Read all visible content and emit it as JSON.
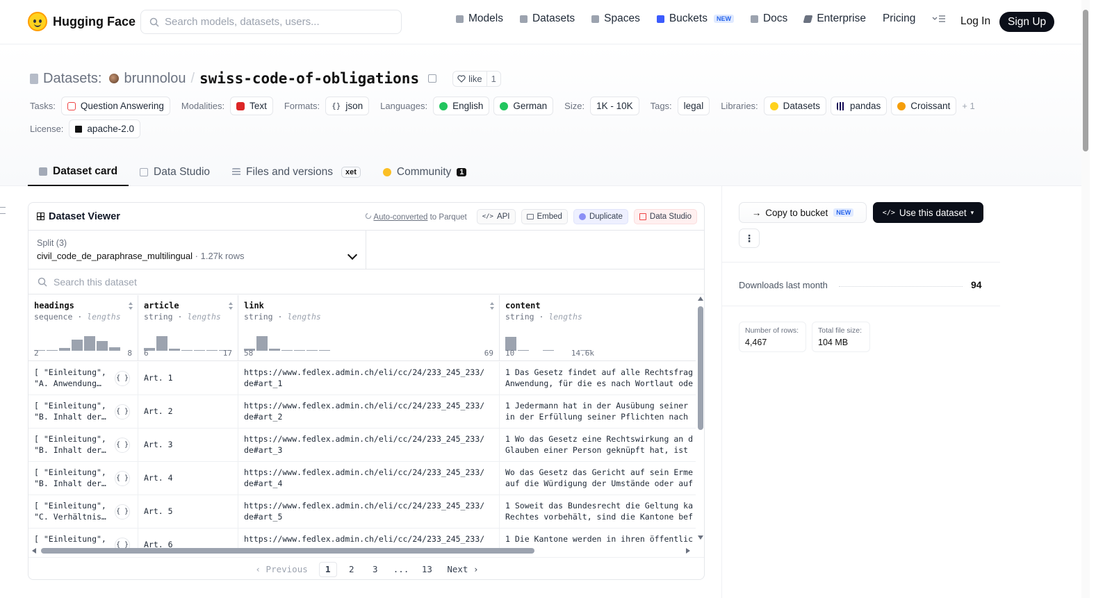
{
  "nav": {
    "brand": "Hugging Face",
    "search_placeholder": "Search models, datasets, users...",
    "items": [
      {
        "label": "Models",
        "icon": "cube-icon"
      },
      {
        "label": "Datasets",
        "icon": "database-icon"
      },
      {
        "label": "Spaces",
        "icon": "grid-icon"
      },
      {
        "label": "Buckets",
        "icon": "bucket-icon",
        "tag": "NEW"
      },
      {
        "label": "Docs",
        "icon": "book-icon"
      },
      {
        "label": "Enterprise",
        "icon": "building-icon"
      },
      {
        "label": "Pricing"
      }
    ],
    "login": "Log In",
    "signup": "Sign Up"
  },
  "header": {
    "prefix": "Datasets:",
    "owner": "brunnolou",
    "repo": "swiss-code-of-obligations",
    "like_label": "like",
    "like_count": "1",
    "tasks_label": "Tasks:",
    "task": "Question Answering",
    "modalities_label": "Modalities:",
    "modality": "Text",
    "formats_label": "Formats:",
    "format": "json",
    "languages_label": "Languages:",
    "languages": [
      "English",
      "German"
    ],
    "size_label": "Size:",
    "size": "1K - 10K",
    "tags_label": "Tags:",
    "tag": "legal",
    "libraries_label": "Libraries:",
    "libraries": [
      "Datasets",
      "pandas",
      "Croissant"
    ],
    "more": "+ 1",
    "license_label": "License:",
    "license": "apache-2.0"
  },
  "tabs": [
    {
      "label": "Dataset card",
      "active": true
    },
    {
      "label": "Data Studio"
    },
    {
      "label": "Files and versions",
      "extra": "xet"
    },
    {
      "label": "Community",
      "badge": "1"
    }
  ],
  "viewer": {
    "title": "Dataset Viewer",
    "autoconv_link": "Auto-converted",
    "autoconv_rest": " to Parquet",
    "buttons": [
      "API",
      "Embed",
      "Duplicate",
      "Data Studio"
    ],
    "split_label": "Split (3)",
    "split_value": "civil_code_de_paraphrase_multilingual",
    "split_rows": "1.27k rows",
    "search_placeholder": "Search this dataset",
    "columns": [
      {
        "name": "headings",
        "type": "sequence",
        "hint": "lengths",
        "min": "2",
        "max": "8",
        "hist": [
          0.05,
          0.05,
          0.15,
          0.6,
          0.8,
          0.55,
          0.2
        ]
      },
      {
        "name": "article",
        "type": "string",
        "hint": "lengths",
        "min": "6",
        "max": "17",
        "hist": [
          0.15,
          0.8,
          0.12,
          0.05,
          0.05,
          0.05,
          0.05
        ]
      },
      {
        "name": "link",
        "type": "string",
        "hint": "lengths",
        "min": "58",
        "max": "69",
        "hist": [
          0.1,
          0.8,
          0.12,
          0.05,
          0.05,
          0.05,
          0.05
        ]
      },
      {
        "name": "content",
        "type": "string",
        "hint": "lengths",
        "min": "10",
        "max": "14.6k",
        "hist": [
          0.75,
          0.04,
          0,
          0.03,
          0,
          0,
          0.03
        ]
      }
    ],
    "rows": [
      {
        "headings": "[ \"Einleitung\",\n\"A. Anwendung…",
        "article": "Art. 1",
        "link": "https://www.fedlex.admin.ch/eli/cc/24/233_245_233/\nde#art_1",
        "content": "1 Das Gesetz findet auf alle Rechtsfrag\nAnwendung, für die es nach Wortlaut ode"
      },
      {
        "headings": "[ \"Einleitung\",\n\"B. Inhalt der…",
        "article": "Art. 2",
        "link": "https://www.fedlex.admin.ch/eli/cc/24/233_245_233/\nde#art_2",
        "content": "1 Jedermann hat in der Ausübung seiner\nin der Erfüllung seiner Pflichten nach"
      },
      {
        "headings": "[ \"Einleitung\",\n\"B. Inhalt der…",
        "article": "Art. 3",
        "link": "https://www.fedlex.admin.ch/eli/cc/24/233_245_233/\nde#art_3",
        "content": "1 Wo das Gesetz eine Rechtswirkung an d\nGlauben einer Person geknüpft hat, ist"
      },
      {
        "headings": "[ \"Einleitung\",\n\"B. Inhalt der…",
        "article": "Art. 4",
        "link": "https://www.fedlex.admin.ch/eli/cc/24/233_245_233/\nde#art_4",
        "content": "Wo das Gesetz das Gericht auf sein Erme\nauf die Würdigung der Umstände oder auf"
      },
      {
        "headings": "[ \"Einleitung\",\n\"C. Verhältnis…",
        "article": "Art. 5",
        "link": "https://www.fedlex.admin.ch/eli/cc/24/233_245_233/\nde#art_5",
        "content": "1 Soweit das Bundesrecht die Geltung ka\nRechtes vorbehält, sind die Kantone bef"
      },
      {
        "headings": "[ \"Einleitung\",",
        "article": "Art. 6",
        "link": "https://www.fedlex.admin.ch/eli/cc/24/233_245_233/",
        "content": "1 Die Kantone werden in ihren öffentlic"
      }
    ],
    "json_icon_label": "{ }",
    "pager": {
      "prev": "Previous",
      "pages": [
        "1",
        "2",
        "3",
        "...",
        "13"
      ],
      "current": "1",
      "next": "Next"
    }
  },
  "sidebar": {
    "copy_label": "Copy to bucket",
    "copy_tag": "NEW",
    "use_label": "Use this dataset",
    "downloads_label": "Downloads last month",
    "downloads_value": "94",
    "rows_label": "Number of rows:",
    "rows_value": "4,467",
    "size_label": "Total file size:",
    "size_value": "104 MB"
  },
  "colors": {
    "brand_yellow": "#ffd21e",
    "dark_button": "#0b0f19",
    "border": "#e5e7eb",
    "muted_text": "#6b7280"
  }
}
